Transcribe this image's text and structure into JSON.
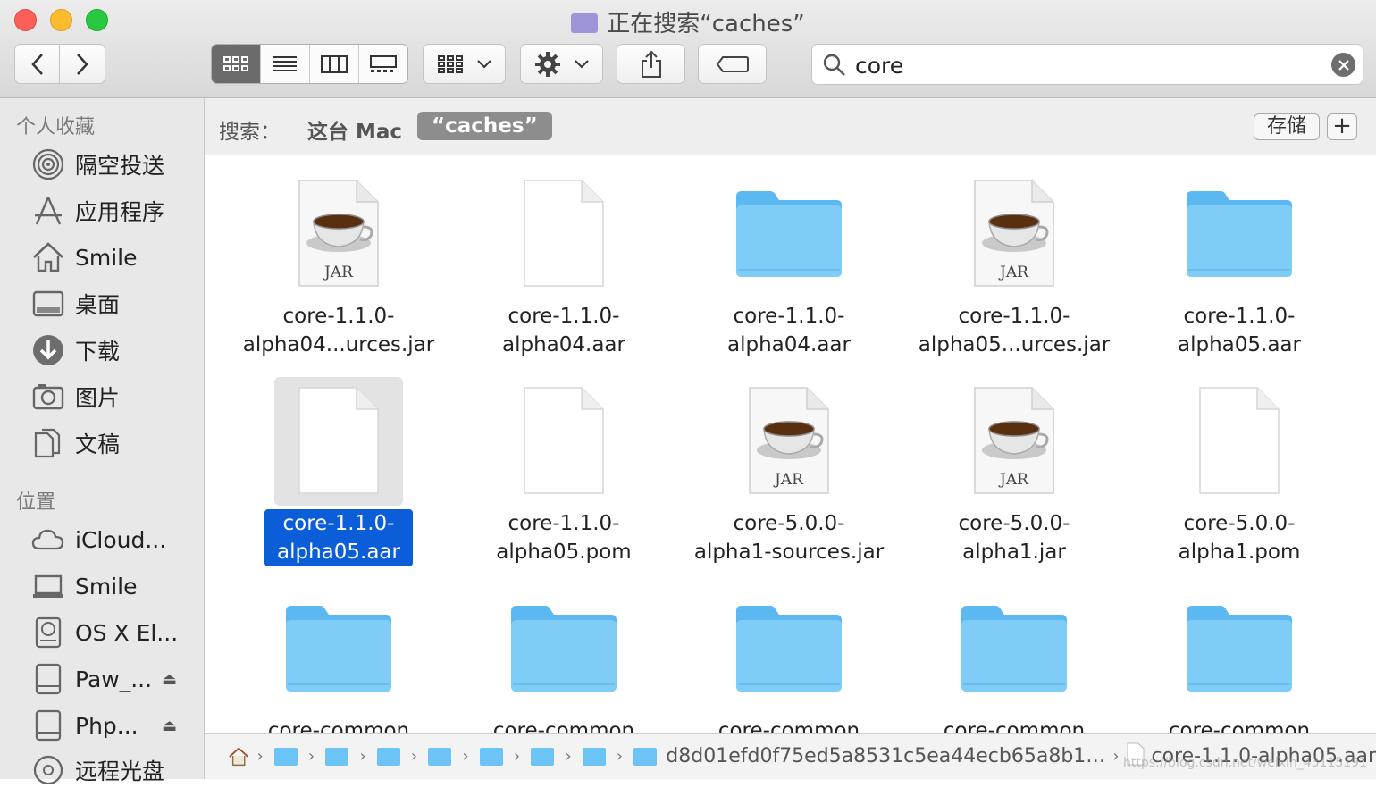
{
  "window": {
    "title": "正在搜索“caches”",
    "traffic": [
      "close",
      "minimize",
      "zoom"
    ]
  },
  "toolbar": {
    "back_icon": "chevron-left-icon",
    "forward_icon": "chevron-right-icon",
    "view_modes": [
      "icon-view",
      "list-view",
      "column-view",
      "gallery-view"
    ],
    "active_view": "icon-view",
    "group_icon": "group-grid-icon",
    "action_icon": "gear-icon",
    "share_icon": "share-icon",
    "tag_icon": "tag-icon"
  },
  "search": {
    "value": "core",
    "clear_icon": "clear-icon"
  },
  "sidebar": {
    "favorites_header": "个人收藏",
    "favorites": [
      {
        "label": "隔空投送",
        "icon": "airdrop-icon"
      },
      {
        "label": "应用程序",
        "icon": "applications-icon"
      },
      {
        "label": "Smile",
        "icon": "home-icon"
      },
      {
        "label": "桌面",
        "icon": "desktop-icon"
      },
      {
        "label": "下载",
        "icon": "downloads-icon"
      },
      {
        "label": "图片",
        "icon": "pictures-icon"
      },
      {
        "label": "文稿",
        "icon": "documents-icon"
      }
    ],
    "locations_header": "位置",
    "locations": [
      {
        "label": "iCloud...",
        "icon": "cloud-icon"
      },
      {
        "label": "Smile",
        "icon": "laptop-icon"
      },
      {
        "label": "OS X El...",
        "icon": "disk-icon"
      },
      {
        "label": "Paw_...",
        "icon": "external-disk-icon",
        "eject": true
      },
      {
        "label": "Php...",
        "icon": "external-disk-icon",
        "eject": true
      },
      {
        "label": "远程光盘",
        "icon": "remote-disc-icon"
      }
    ]
  },
  "scope": {
    "label": "搜索：",
    "this_mac": "这台 Mac",
    "current": "“caches”",
    "save": "存储",
    "add": "+"
  },
  "files": [
    {
      "line1": "core-1.1.0-",
      "line2": "alpha04...urces.jar",
      "kind": "jar"
    },
    {
      "line1": "core-1.1.0-",
      "line2": "alpha04.aar",
      "kind": "doc"
    },
    {
      "line1": "core-1.1.0-",
      "line2": "alpha04.aar",
      "kind": "folder"
    },
    {
      "line1": "core-1.1.0-",
      "line2": "alpha05...urces.jar",
      "kind": "jar"
    },
    {
      "line1": "core-1.1.0-",
      "line2": "alpha05.aar",
      "kind": "folder"
    },
    {
      "line1": "core-1.1.0-",
      "line2": "alpha05.aar",
      "kind": "doc",
      "selected": true
    },
    {
      "line1": "core-1.1.0-",
      "line2": "alpha05.pom",
      "kind": "doc"
    },
    {
      "line1": "core-5.0.0-",
      "line2": "alpha1-sources.jar",
      "kind": "jar"
    },
    {
      "line1": "core-5.0.0-",
      "line2": "alpha1.jar",
      "kind": "jar"
    },
    {
      "line1": "core-5.0.0-",
      "line2": "alpha1.pom",
      "kind": "doc"
    },
    {
      "line1": "core-common",
      "line2": "",
      "kind": "folder"
    },
    {
      "line1": "core-common",
      "line2": "",
      "kind": "folder"
    },
    {
      "line1": "core-common",
      "line2": "",
      "kind": "folder"
    },
    {
      "line1": "core-common",
      "line2": "",
      "kind": "folder"
    },
    {
      "line1": "core-common",
      "line2": "",
      "kind": "folder"
    }
  ],
  "jar_badge": "JAR",
  "pathbar": {
    "folders_before": 8,
    "hash_folder": "d8d01efd0f75ed5a8531c5ea44ecb65a8b1…",
    "file": "core-1.1.0-alpha05.aar"
  },
  "watermark": "https://blog.csdn.net/weixin_43115191",
  "colors": {
    "folder": "#6cc3f5",
    "selection": "#0b5ed7",
    "sidebar_bg": "#e8e8e8"
  }
}
